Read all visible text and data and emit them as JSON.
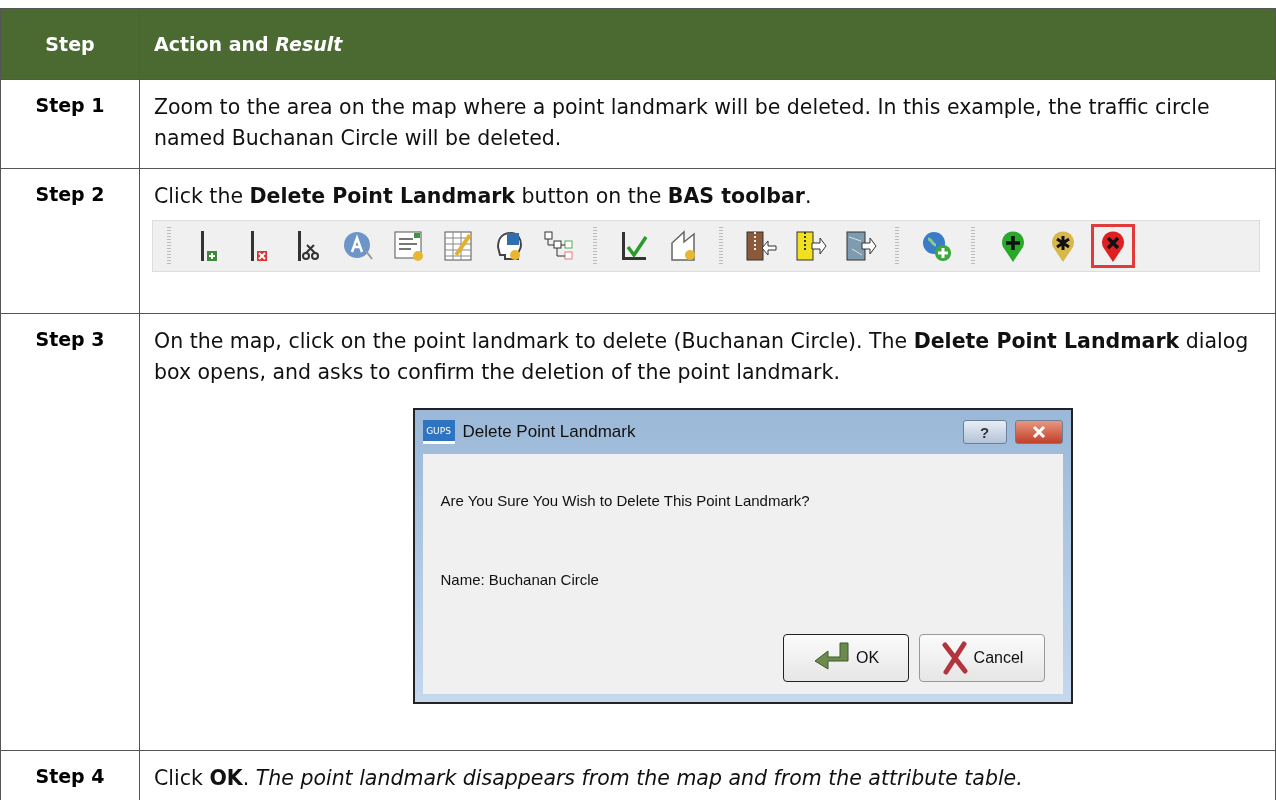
{
  "table": {
    "columns": [
      "Step",
      "Action and *Result*"
    ],
    "rows": [
      {
        "step": "Step 1",
        "text": "Zoom to the area on the map where a point landmark will be deleted. In this example, the traffic circle named Buchanan Circle will be deleted."
      },
      {
        "step": "Step 2",
        "text": "Click the **Delete Point Landmark** button on the **BAS toolbar**.",
        "figure": {
          "kind": "toolbar",
          "groups": [
            [
              {
                "kind": "add-line",
                "selected": false
              },
              {
                "kind": "delete-line",
                "selected": false
              },
              {
                "kind": "split-line",
                "selected": false
              },
              {
                "kind": "label",
                "selected": false
              },
              {
                "kind": "form",
                "selected": false
              },
              {
                "kind": "table",
                "selected": false
              },
              {
                "kind": "head",
                "selected": false
              },
              {
                "kind": "tree",
                "selected": false
              }
            ],
            [
              {
                "kind": "check",
                "selected": false
              },
              {
                "kind": "page",
                "selected": false
              }
            ],
            [
              {
                "kind": "zip-brown",
                "selected": false
              },
              {
                "kind": "zip-yellow",
                "selected": false
              },
              {
                "kind": "map-export",
                "selected": false
              }
            ],
            [
              {
                "kind": "globe-add",
                "selected": false
              }
            ],
            [
              {
                "kind": "pin-plus",
                "selected": false
              },
              {
                "kind": "pin-star",
                "selected": false
              },
              {
                "kind": "pin-x",
                "selected": true
              }
            ]
          ]
        }
      },
      {
        "step": "Step 3",
        "text": "On the map, click on the point landmark to delete (Buchanan Circle). The **Delete Point Landmark** dialog box opens, and asks to confirm the deletion of the point landmark.",
        "figure": {
          "kind": "dialog",
          "app_icon": "GUPS",
          "title": "Delete Point Landmark",
          "help": "?",
          "message": "Are You Sure You Wish to Delete This Point Landmark?",
          "name": "Name: Buchanan Circle",
          "buttons": [
            {
              "kind": "ok",
              "label": "OK",
              "selected": true
            },
            {
              "kind": "cancel",
              "label": "Cancel",
              "selected": false
            }
          ]
        }
      },
      {
        "step": "Step 4",
        "text": "Click **OK**. *The point landmark disappears from the map and from the attribute table.*"
      }
    ]
  }
}
